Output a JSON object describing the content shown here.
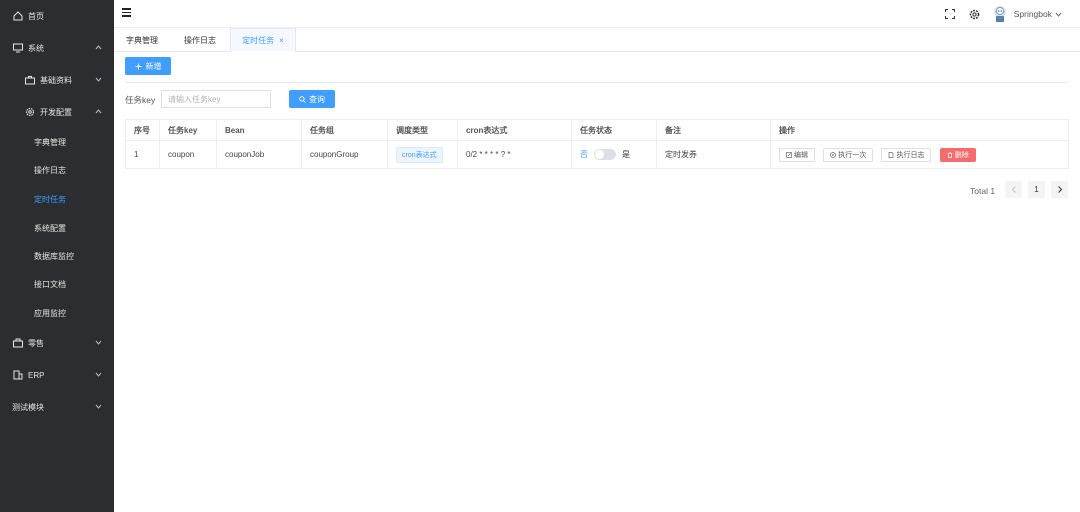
{
  "sidebar": {
    "items": [
      {
        "label": "首页",
        "icon": "home-icon"
      },
      {
        "label": "系统",
        "icon": "monitor-icon"
      },
      {
        "label": "基础资料",
        "icon": "suitcase-icon"
      },
      {
        "label": "开发配置",
        "icon": "gear-icon"
      },
      {
        "label": "字典管理"
      },
      {
        "label": "操作日志"
      },
      {
        "label": "定时任务",
        "active": true
      },
      {
        "label": "系统配置"
      },
      {
        "label": "数据库监控"
      },
      {
        "label": "接口文档"
      },
      {
        "label": "应用监控"
      },
      {
        "label": "零售",
        "icon": "shop-icon"
      },
      {
        "label": "ERP",
        "icon": "building-icon"
      },
      {
        "label": "测试模块"
      }
    ]
  },
  "header": {
    "username": "Springbok"
  },
  "tabs": [
    {
      "label": "字典管理"
    },
    {
      "label": "操作日志"
    },
    {
      "label": "定时任务",
      "active": true,
      "close": "×"
    }
  ],
  "toolbar": {
    "add_label": "新增"
  },
  "filter": {
    "label": "任务key",
    "placeholder": "请输入任务key",
    "search_label": "查询"
  },
  "table": {
    "headers": [
      "序号",
      "任务key",
      "Bean",
      "任务组",
      "调度类型",
      "cron表达式",
      "任务状态",
      "备注",
      "操作"
    ],
    "rows": [
      {
        "index": "1",
        "key": "coupon",
        "bean": "couponJob",
        "group": "couponGroup",
        "type": "cron表达式",
        "cron": "0/2 * * * * ? *",
        "status_off": "否",
        "status_on": "是",
        "remark": "定时发券",
        "actions": {
          "edit": "编辑",
          "run_once": "执行一次",
          "log": "执行日志",
          "delete": "删除"
        }
      }
    ]
  },
  "pagination": {
    "total": "Total 1",
    "page": "1"
  },
  "colors": {
    "primary": "#409eff",
    "danger": "#f56c6c",
    "sidebar_bg": "#2b2d30"
  }
}
